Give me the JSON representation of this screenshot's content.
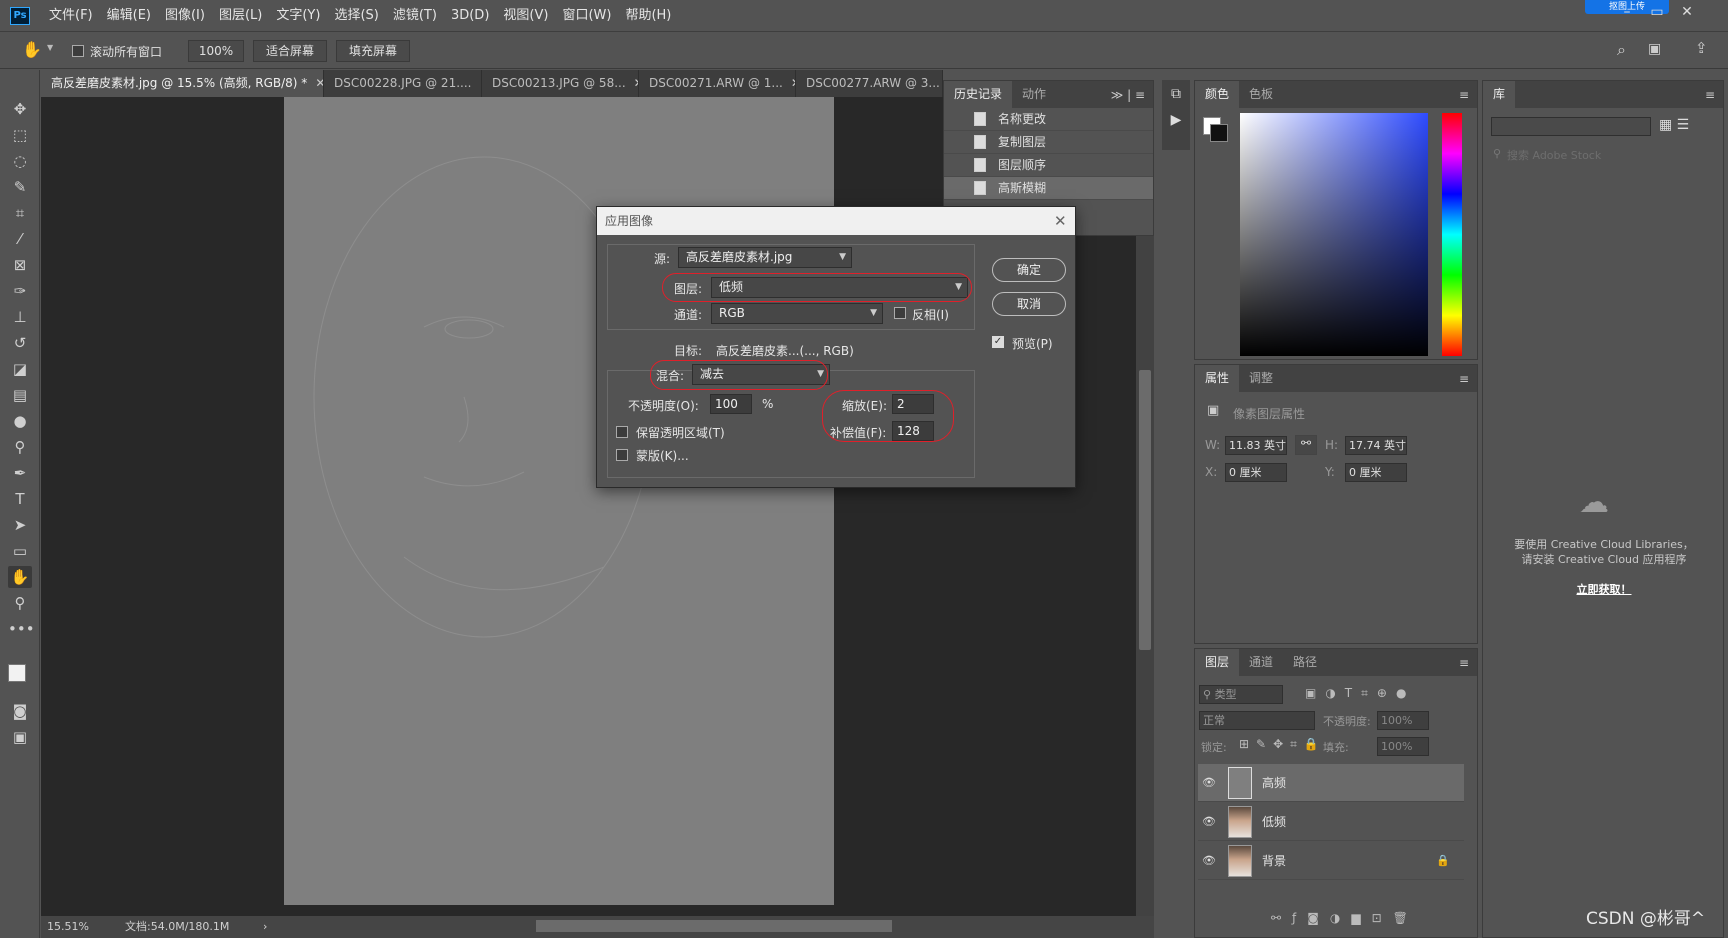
{
  "app": {
    "logo": "Ps",
    "cloud_button": "抠图上传"
  },
  "menu": [
    "文件(F)",
    "编辑(E)",
    "图像(I)",
    "图层(L)",
    "文字(Y)",
    "选择(S)",
    "滤镜(T)",
    "3D(D)",
    "视图(V)",
    "窗口(W)",
    "帮助(H)"
  ],
  "options": {
    "scroll_all": "滚动所有窗口",
    "zoom": "100%",
    "fit_screen": "适合屏幕",
    "fill_screen": "填充屏幕"
  },
  "tabs": [
    {
      "label": "高反差磨皮素材.jpg @ 15.5% (高频, RGB/8) *"
    },
    {
      "label": "DSC00228.JPG @ 21...."
    },
    {
      "label": "DSC00213.JPG @ 58..."
    },
    {
      "label": "DSC00271.ARW @ 1..."
    },
    {
      "label": "DSC00277.ARW @ 3..."
    }
  ],
  "status": {
    "zoom": "15.51%",
    "doc": "文档:54.0M/180.1M"
  },
  "history": {
    "tabs": [
      "历史记录",
      "动作"
    ],
    "items": [
      "名称更改",
      "复制图层",
      "图层顺序",
      "高斯模糊"
    ]
  },
  "color_panel": {
    "tabs": [
      "颜色",
      "色板"
    ]
  },
  "properties": {
    "tabs": [
      "属性",
      "调整"
    ],
    "title": "像素图层属性",
    "w_label": "W:",
    "w": "11.83 英寸",
    "h_label": "H:",
    "h": "17.74 英寸",
    "x_label": "X:",
    "x": "0 厘米",
    "y_label": "Y:",
    "y": "0 厘米"
  },
  "layers_panel": {
    "tabs": [
      "图层",
      "通道",
      "路径"
    ],
    "filter": "类型",
    "blend": "正常",
    "opacity_label": "不透明度:",
    "opacity": "100%",
    "lock_label": "锁定:",
    "fill_label": "填充:",
    "fill": "100%",
    "layers": [
      {
        "name": "高频",
        "selected": true
      },
      {
        "name": "低频",
        "selected": false
      },
      {
        "name": "背景",
        "selected": false,
        "locked": true
      }
    ]
  },
  "library": {
    "tab": "库",
    "search_placeholder": "搜索 Adobe Stock",
    "message1": "要使用 Creative Cloud Libraries，",
    "message2": "请安装 Creative Cloud 应用程序",
    "link": "立即获取！"
  },
  "dialog": {
    "title": "应用图像",
    "source_label": "源:",
    "source": "高反差磨皮素材.jpg",
    "layer_label": "图层:",
    "layer": "低频",
    "channel_label": "通道:",
    "channel": "RGB",
    "invert": "反相(I)",
    "target_label": "目标:",
    "target": "高反差磨皮素...(..., RGB)",
    "blend_label": "混合:",
    "blend": "减去",
    "opacity_label": "不透明度(O):",
    "opacity": "100",
    "percent": "%",
    "scale_label": "缩放(E):",
    "scale": "2",
    "offset_label": "补偿值(F):",
    "offset": "128",
    "preserve": "保留透明区域(T)",
    "mask": "蒙版(K)...",
    "ok": "确定",
    "cancel": "取消",
    "preview": "预览(P)"
  },
  "watermark": "CSDN @彬哥^"
}
